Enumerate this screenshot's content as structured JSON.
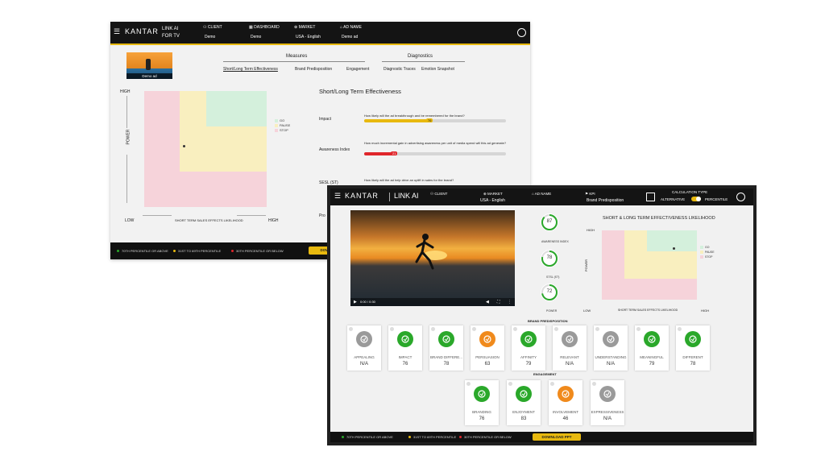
{
  "colors": {
    "green": "#2aa82a",
    "orange": "#f08a1c",
    "red": "#e0262b",
    "gray": "#9a9a9a",
    "gold": "#e8b90f",
    "go": "#d4f0dc",
    "pause": "#f9efbf",
    "stop": "#f6d3da"
  },
  "back": {
    "header": {
      "brand": "KANTAR",
      "app": [
        "LINK AI",
        "FOR TV"
      ],
      "fields": [
        {
          "label": "CLIENT",
          "value": "Demo",
          "icon": "person-icon"
        },
        {
          "label": "DASHBOARD",
          "value": "Demo",
          "icon": "grid-icon"
        },
        {
          "label": "MARKET",
          "value": "USA - English",
          "icon": "globe-icon"
        },
        {
          "label": "AD NAME",
          "value": "Demo ad",
          "icon": "tag-icon"
        }
      ]
    },
    "thumb_caption": "Demo ad",
    "measures_title": "Measures",
    "diagnostics_title": "Diagnostics",
    "tabs": [
      "Short/Long Term Effectiveness",
      "Brand Predisposition",
      "Engagement",
      "Diagnostic Traces",
      "Emotion Snapshot"
    ],
    "section_title": "Short/Long Term Effectiveness",
    "metrics": [
      {
        "name": "Impact",
        "question": "How likely will the ad breakthrough and be remembered for the brand?",
        "value": "76",
        "fraction": 0.46
      },
      {
        "name": "Awareness Index",
        "question": "How much incremental gain in advertising awareness per unit of media spend will this ad generate?",
        "value": "21",
        "fraction": 0.21
      },
      {
        "name": "SESL (ST)",
        "question": "How likely will the ad help drive an uplift in sales for the brand?",
        "value": "",
        "fraction": 0
      }
    ],
    "truncated_label": "Pro",
    "chart": {
      "y_high": "HIGH",
      "y_label": "POWER",
      "x_low": "LOW",
      "x_label": "SHORT TERM SALES EFFECTS LIKELIHOOD",
      "x_high": "HIGH"
    },
    "legend": [
      "GO",
      "PAUSE",
      "STOP"
    ],
    "footer": [
      "70TH PERCENTILE OR ABOVE",
      "31ST TO 69TH PERCENTILE",
      "30TH PERCENTILE OR BELOW"
    ],
    "download": "DOW"
  },
  "front": {
    "header": {
      "brand": "KANTAR",
      "app": "LINK AI",
      "fields": [
        {
          "label": "CLIENT",
          "value": "",
          "icon": "person-icon"
        },
        {
          "label": "MARKET",
          "value": "USA - English",
          "icon": "globe-icon"
        },
        {
          "label": "AD NAME",
          "value": "",
          "icon": "tag-icon"
        },
        {
          "label": "KPI",
          "value": "Brand Predisposition",
          "icon": "kpi-icon"
        }
      ],
      "calc_title": "CALCULATION TYPE",
      "calc_left": "ALTERNATIVE",
      "calc_right": "PERCENTILE"
    },
    "video": {
      "time": "0:00 / 0:30"
    },
    "gauges": [
      {
        "value": "87",
        "label": "AWARENESS INDEX",
        "fraction": 0.87
      },
      {
        "value": "78",
        "label": "STSL (ST)",
        "fraction": 0.78
      },
      {
        "value": "72",
        "label": "POWER",
        "fraction": 0.72
      }
    ],
    "chart": {
      "title": "SHORT & LONG TERM EFFECTIVENESS LIKELIHOOD",
      "y_high": "HIGH",
      "y_label": "POWER",
      "x_low": "LOW",
      "x_label": "SHORT TERM SALES EFFECTS LIKELIHOOD",
      "x_high": "HIGH"
    },
    "legend": [
      "GO",
      "PAUSE",
      "STOP"
    ],
    "brand_title": "BRAND PREDISPOSITION",
    "brand_cards": [
      {
        "label": "APPEALING",
        "value": "N/A",
        "status": "gray",
        "icon": "appealing-icon"
      },
      {
        "label": "IMPACT",
        "value": "76",
        "status": "green",
        "icon": "impact-icon"
      },
      {
        "label": "BRAND DIFFERE...",
        "value": "78",
        "status": "green",
        "icon": "brand-difference-icon"
      },
      {
        "label": "PERSUASION",
        "value": "63",
        "status": "orange",
        "icon": "persuasion-icon"
      },
      {
        "label": "AFFINITY",
        "value": "79",
        "status": "green",
        "icon": "affinity-icon"
      },
      {
        "label": "RELEVANT",
        "value": "N/A",
        "status": "gray",
        "icon": "relevant-icon"
      },
      {
        "label": "UNDERSTANDING",
        "value": "N/A",
        "status": "gray",
        "icon": "understanding-icon"
      },
      {
        "label": "MEANINGFUL",
        "value": "79",
        "status": "green",
        "icon": "meaningful-icon"
      },
      {
        "label": "DIFFERENT",
        "value": "78",
        "status": "green",
        "icon": "different-icon"
      }
    ],
    "engagement_title": "ENGAGEMENT",
    "engagement_cards": [
      {
        "label": "BRANDING",
        "value": "76",
        "status": "green",
        "icon": "branding-icon"
      },
      {
        "label": "ENJOYMENT",
        "value": "83",
        "status": "green",
        "icon": "enjoyment-icon"
      },
      {
        "label": "INVOLVEMENT",
        "value": "46",
        "status": "orange",
        "icon": "involvement-icon"
      },
      {
        "label": "EXPRESSIVENESS",
        "value": "N/A",
        "status": "gray",
        "icon": "expressiveness-icon"
      }
    ],
    "footer": [
      "70TH PERCENTILE OR ABOVE",
      "31ST TO 69TH PERCENTILE",
      "30TH PERCENTILE OR BELOW"
    ],
    "download": "DOWNLOAD PPT"
  }
}
